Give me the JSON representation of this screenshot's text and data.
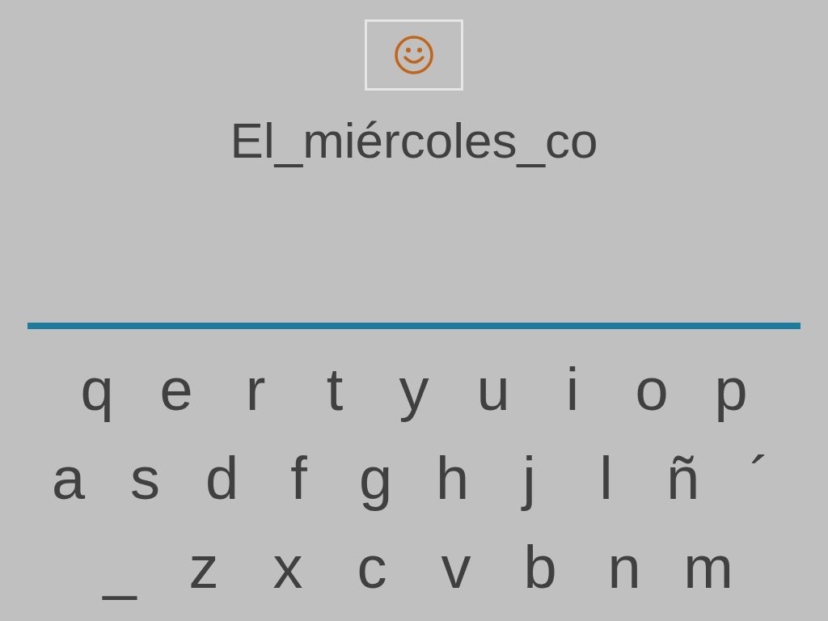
{
  "phrase": "El_miércoles_co",
  "keyboard": {
    "rows": [
      [
        "q",
        "e",
        "r",
        "t",
        "y",
        "u",
        "i",
        "o",
        "p"
      ],
      [
        "a",
        "s",
        "d",
        "f",
        "g",
        "h",
        "j",
        "l",
        "ñ",
        "´"
      ],
      [
        "_",
        "z",
        "x",
        "c",
        "v",
        "b",
        "n",
        "m"
      ]
    ]
  }
}
